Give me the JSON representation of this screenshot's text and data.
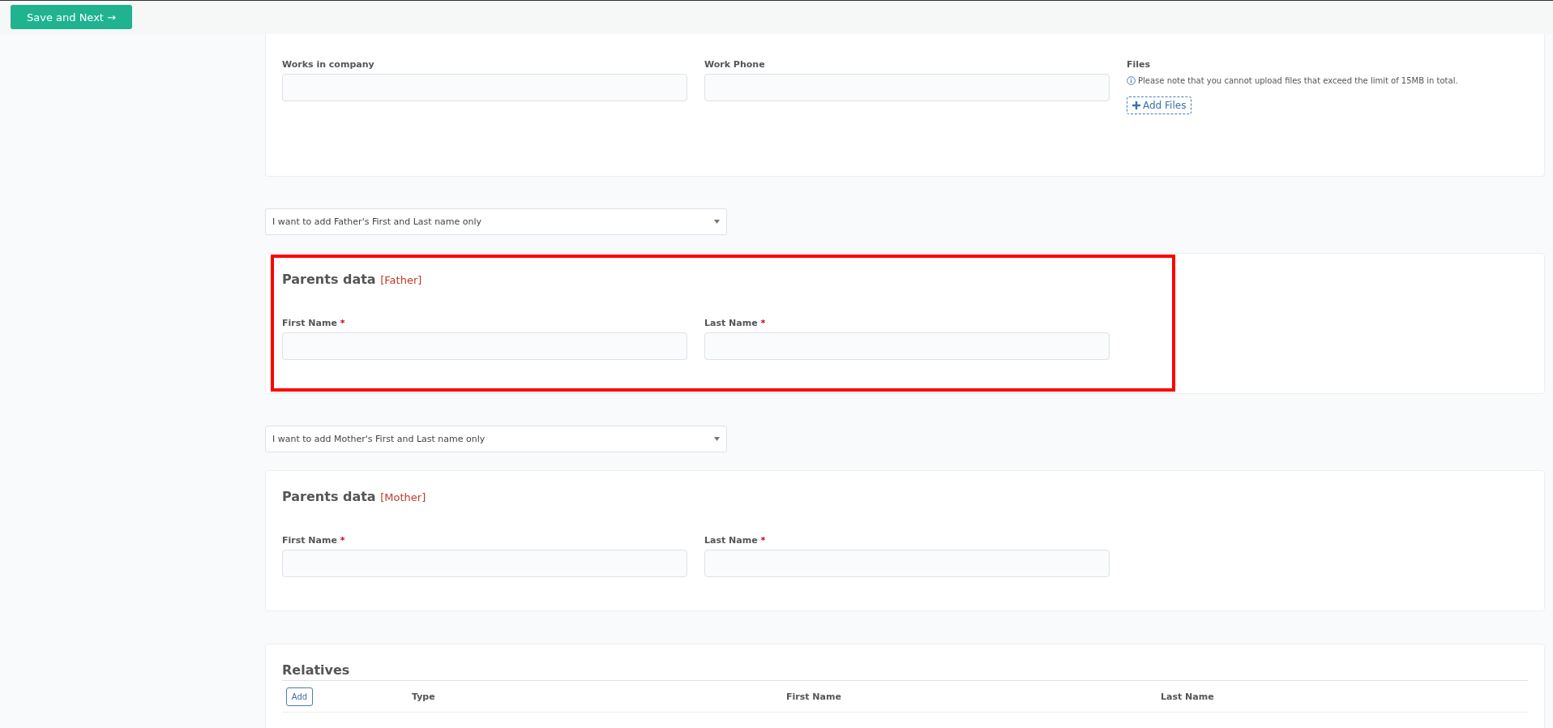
{
  "toolbar": {
    "save_button": "Save and Next →"
  },
  "work_section": {
    "fields": [
      {
        "label": "Works in company"
      },
      {
        "label": "Work Phone"
      }
    ],
    "files": {
      "label": "Files",
      "note": "Please note that you cannot upload files that exceed the limit of 15MB in total.",
      "add_button": "Add Files"
    }
  },
  "father_select": {
    "value": "I want to add Father's First and Last name only"
  },
  "father_section": {
    "title": "Parents data",
    "tag": "[Father]",
    "highlighted": true,
    "fields": [
      {
        "label": "First Name",
        "required_mark": "*"
      },
      {
        "label": "Last Name",
        "required_mark": "*"
      }
    ]
  },
  "mother_select": {
    "value": "I want to add Mother's First and Last name only"
  },
  "mother_section": {
    "title": "Parents data",
    "tag": "[Mother]",
    "highlighted": false,
    "fields": [
      {
        "label": "First Name",
        "required_mark": "*"
      },
      {
        "label": "Last Name",
        "required_mark": "*"
      }
    ]
  },
  "relatives": {
    "title": "Relatives",
    "add_button": "Add",
    "columns": [
      "Type",
      "First Name",
      "Last Name"
    ]
  }
}
